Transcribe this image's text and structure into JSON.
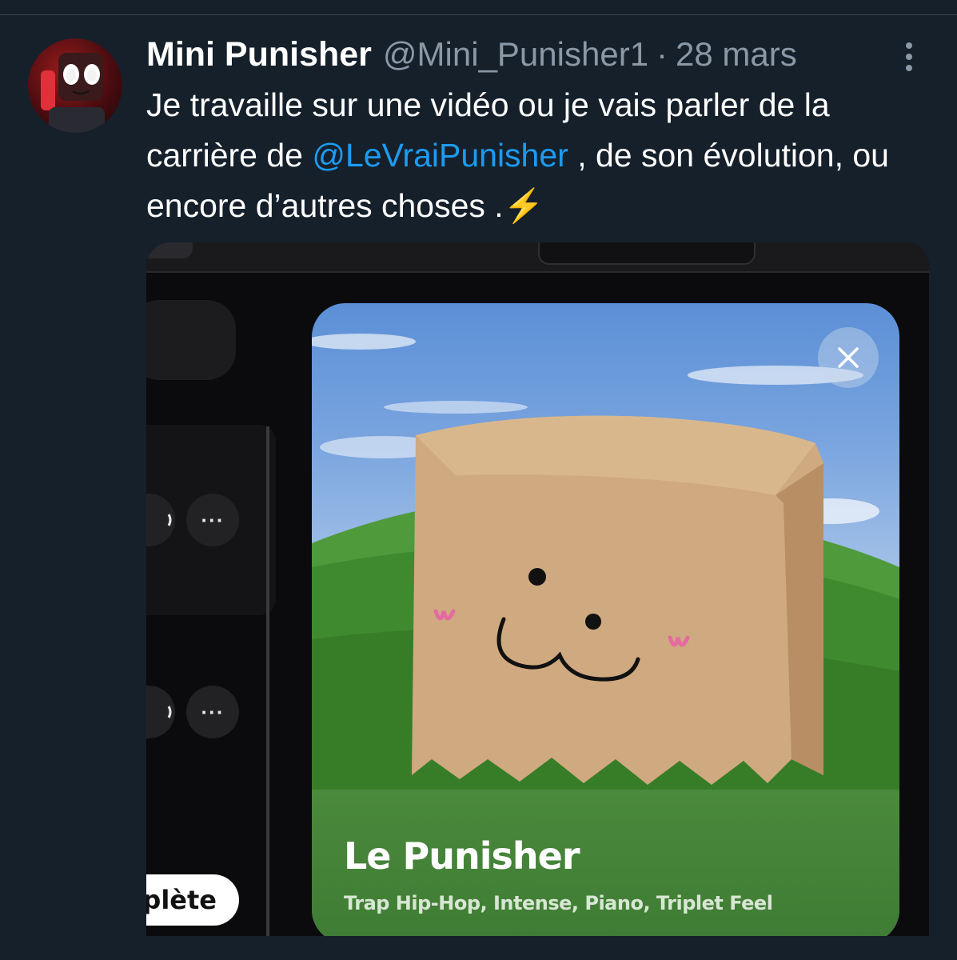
{
  "tweet": {
    "author_name": "Mini Punisher",
    "handle": "@Mini_Punisher1",
    "separator": "·",
    "date": "28 mars",
    "text_before_mention": "Je travaille sur une vidéo ou je vais parler de la carrière de ",
    "mention": "@LeVraiPunisher",
    "text_after_mention": " , de son évolution, ou encore d’autres choses .⚡"
  },
  "media": {
    "left_buttons": [
      {
        "partial_label": " ",
        "more_label": "···"
      },
      {
        "partial_label": " ",
        "more_label": "···"
      }
    ],
    "partial_button_label": "plète",
    "card": {
      "title": "Le Punisher",
      "subtitle": "Trap Hip-Hop, Intense, Piano, Triplet Feel"
    }
  },
  "colors": {
    "background": "#15202b",
    "mention": "#1d9bf0",
    "secondary_text": "#8b98a5"
  },
  "icons": [
    "more-vertical-icon",
    "close-icon",
    "more-horizontal-icon"
  ]
}
